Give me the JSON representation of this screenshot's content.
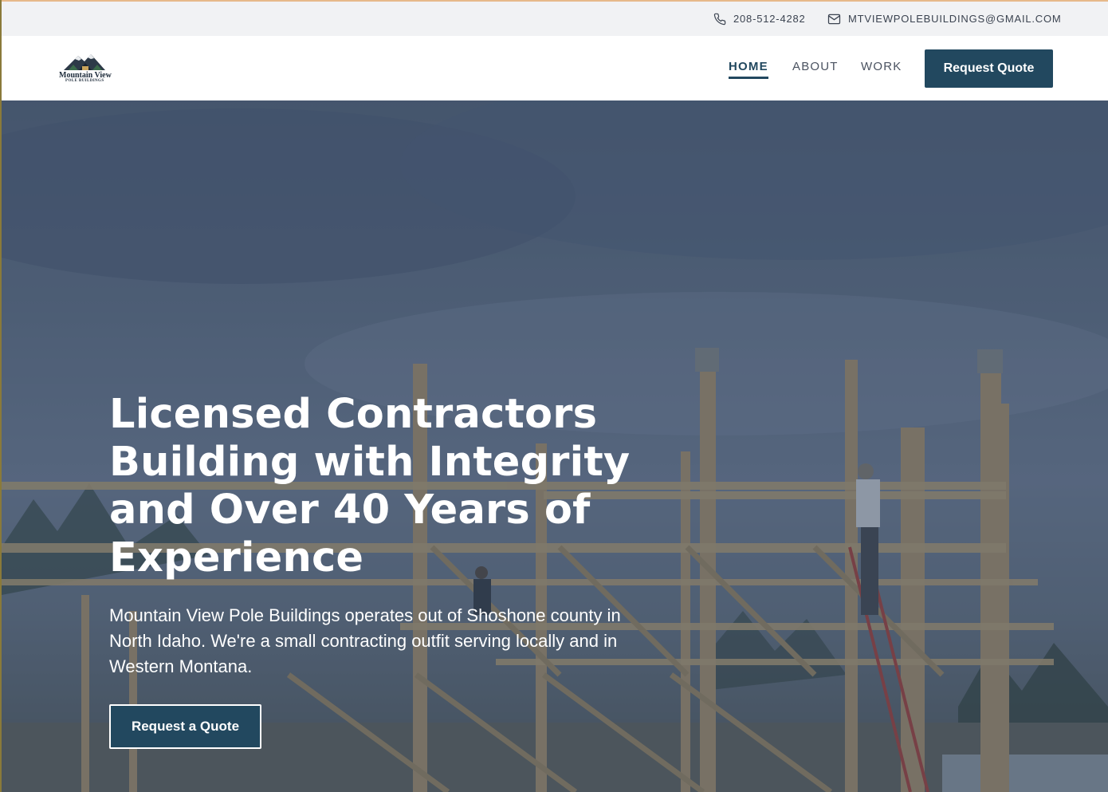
{
  "topbar": {
    "phone": "208-512-4282",
    "email": "MTVIEWPOLEBUILDINGS@GMAIL.COM",
    "phone_icon": "phone-icon",
    "email_icon": "mail-icon"
  },
  "brand": {
    "name": "Mountain View",
    "tagline": "POLE BUILDINGS"
  },
  "nav": {
    "items": [
      {
        "label": "HOME",
        "active": true
      },
      {
        "label": "ABOUT",
        "active": false
      },
      {
        "label": "WORK",
        "active": false
      }
    ],
    "cta": "Request Quote"
  },
  "hero": {
    "title": "Licensed Contractors Building with Integrity and Over 40 Years of Experience",
    "text": "Mountain View Pole Buildings operates out of Shoshone county in North Idaho. We're a small contracting outfit serving locally and in Western Montana.",
    "cta": "Request a Quote"
  },
  "colors": {
    "primary": "#22485f",
    "topbar_bg": "#f1f2f4",
    "nav_text": "#4a5260"
  }
}
